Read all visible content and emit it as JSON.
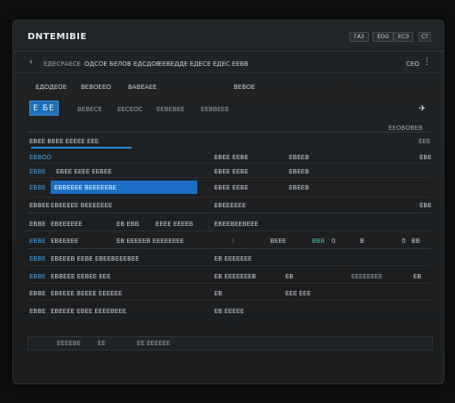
{
  "window": {
    "title": "DNTEMIBIE"
  },
  "titlebar": {
    "btn1": "ГАЗ",
    "btn2": "ЕОО",
    "btn3": "ЕСЭ",
    "btn4": "СТ"
  },
  "nav": {
    "crumb1": "ЕДЕСРАЕСЕ",
    "crumb2": "ОДСОЕ БЕЛОВ ЕДСДОЕ",
    "crumb3": "ЕЕВЕДДЕ ЕДЕСЕ ЕДЕС ЕЕВВ",
    "right_label": "СЕО"
  },
  "tabs": {
    "t1": "ЕДОДЕОЕ",
    "t2": "ВЕВОЕЕО",
    "t3": "ВАВЕАЕЕ",
    "t4": "ВЕВОЕ"
  },
  "subtabs": {
    "active": "Е БЕ",
    "s2": "ВЕВЕСЕ",
    "s3": "ЕЕСЕОС",
    "s4": "ЕЕВЕВЕЕ",
    "s5": "ЕЕВВЕЕЕ"
  },
  "toolbar": {
    "right_label": "ЕЕОВОВЕВ",
    "sub": "ЕЕЕ"
  },
  "section": {
    "header": "ЕВЕЕ ВЕЕЕ ЕЕЕЕЕ ЕЕЕ"
  },
  "rows": [
    {
      "a": "ЕВВОО",
      "b": "",
      "c": "ЕВЕЕ ЕЕВЕ",
      "d": "ЕВЕЕВ",
      "e": "",
      "f": "ЕВЕ"
    },
    {
      "a": "ЕВВЕ",
      "b": "ЕВЕЕ ЕЕЕЕ ЕЕВЕЕ",
      "c": "ЕВЕЕ ЕЕВЕ",
      "d": "ЕВЕЕВ",
      "e": "",
      "f": ""
    },
    {
      "a": "ЕВВЕ",
      "b": "ЕВВЕЕЕЕ ВЕЕЕЕЕВЕ",
      "c": "ЕВЕЕ ЕЕВЕ",
      "d": "ЕВЕЕВ",
      "e": "",
      "f": ""
    },
    {
      "a": "ЕВВЕЕ",
      "b": "ЕВЕЕЕЕЕ ВЕЕЕЕЕЕЕ",
      "c": "ЕВЕЕЕЕЕЕ",
      "d": "",
      "e": "",
      "f": "ЕВЕ"
    },
    {
      "a": "ЕВВЕ",
      "b": "ЕВЕЕЕЕЕЕ",
      "b2": "ЕВ ЕВВ",
      "b3": "ЕЕЕЕ ЕЕЕЕВ",
      "c": "ЕВЕЕВЕЕВЕЕЕ",
      "d": "",
      "e": "",
      "f": ""
    },
    {
      "a": "ЕВВЕ",
      "b": "ЕВЕЕЕЕЕ",
      "b2": "ЕВ ЕЕЕЕЕВ ЕЕЕЕЕЕЕЕ",
      "c": "",
      "n1": "ВЕЕЕ",
      "n2": "ВВВ",
      "n3": "0",
      "n4": "В",
      "n5": "0",
      "n6": "ВВ"
    },
    {
      "a": "ЕВВЕ",
      "b": "ЕВЕЕЕВ ЕЕВЕ ЕВЕЕВЕЕЕВЕЕ",
      "c": "ЕВ ЕЕЕЕЕЕЕ"
    },
    {
      "a": "ЕВВЕ",
      "b": "ЕВВЕЕЕ ЕЕВЕЕ ЕЕЕ",
      "c": "ЕВ ЕЕЕЕЕЕЕВ",
      "d": "ЕВ",
      "e": "ЕЕЕЕЕЕЕЕ",
      "f": "ЕВ"
    },
    {
      "a": "ЕВВЕ",
      "b": "ЕВЕЕЕЕ ВЕЕЕЕ ЕЕЕЕЕЕ",
      "c": "ЕВ",
      "d": "ЕЕЕ ЕЕЕ"
    },
    {
      "a": "ЕВВЕ",
      "b": "ЕВЕЕЕЕ ЕВЕЕ ЕЕЕЕВЕЕЕ",
      "c": "ЕВ ЕЕЕЕЕ"
    }
  ],
  "status": {
    "s1": "ЕЕЕЕВЕ",
    "s2": "ЕЕ",
    "s3": "ЕЕ ЕЕЕЕЕЕ"
  }
}
